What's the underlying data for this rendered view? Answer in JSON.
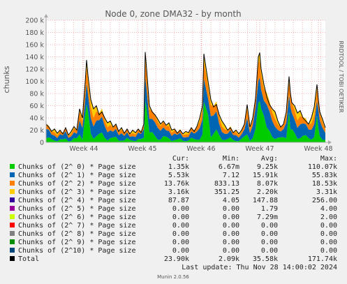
{
  "chart_data": {
    "type": "area",
    "title": "Node 0, zone DMA32 - by month",
    "ylabel": "chunks",
    "ylim": [
      0,
      200000
    ],
    "yticks": [
      0,
      20000,
      40000,
      60000,
      80000,
      100000,
      120000,
      140000,
      160000,
      180000,
      200000
    ],
    "ytick_labels": [
      "0",
      "20 k",
      "40 k",
      "60 k",
      "80 k",
      "100 k",
      "120 k",
      "140 k",
      "160 k",
      "180 k",
      "200 k"
    ],
    "xtick_labels": [
      "Week 44",
      "Week 45",
      "Week 46",
      "Week 47",
      "Week 48"
    ],
    "grid": true,
    "stacked": true,
    "series": [
      {
        "name": "Chunks of (2^ 0) * Page size",
        "color": "#00cc00",
        "cur": "1.35k",
        "min": "6.67m",
        "avg": "9.25k",
        "max": "110.07k"
      },
      {
        "name": "Chunks of (2^ 1) * Page size",
        "color": "#0066b3",
        "cur": "5.53k",
        "min": "7.12",
        "avg": "15.91k",
        "max": "55.83k"
      },
      {
        "name": "Chunks of (2^ 2) * Page size",
        "color": "#ff8000",
        "cur": "13.76k",
        "min": "833.13",
        "avg": "8.07k",
        "max": "18.53k"
      },
      {
        "name": "Chunks of (2^ 3) * Page size",
        "color": "#ffcc00",
        "cur": "3.16k",
        "min": "351.25",
        "avg": "2.20k",
        "max": "3.31k"
      },
      {
        "name": "Chunks of (2^ 4) * Page size",
        "color": "#330099",
        "cur": "87.87",
        "min": "4.05",
        "avg": "147.88",
        "max": "256.00"
      },
      {
        "name": "Chunks of (2^ 5) * Page size",
        "color": "#990099",
        "cur": "0.00",
        "min": "0.00",
        "avg": "1.79",
        "max": "4.00"
      },
      {
        "name": "Chunks of (2^ 6) * Page size",
        "color": "#ccff00",
        "cur": "0.00",
        "min": "0.00",
        "avg": "7.29m",
        "max": "2.00"
      },
      {
        "name": "Chunks of (2^ 7) * Page size",
        "color": "#ff0000",
        "cur": "0.00",
        "min": "0.00",
        "avg": "0.00",
        "max": "0.00"
      },
      {
        "name": "Chunks of (2^ 8) * Page size",
        "color": "#808080",
        "cur": "0.00",
        "min": "0.00",
        "avg": "0.00",
        "max": "0.00"
      },
      {
        "name": "Chunks of (2^ 9) * Page size",
        "color": "#008f00",
        "cur": "0.00",
        "min": "0.00",
        "avg": "0.00",
        "max": "0.00"
      },
      {
        "name": "Chunks of (2^10) * Page size",
        "color": "#00487d",
        "cur": "0.00",
        "min": "0.00",
        "avg": "0.00",
        "max": "0.00"
      },
      {
        "name": "Total",
        "color": "#000000",
        "cur": "23.90k",
        "min": "2.09k",
        "avg": "35.58k",
        "max": "171.74k"
      }
    ],
    "column_headers": [
      "Cur:",
      "Min:",
      "Avg:",
      "Max:"
    ],
    "profile": [
      [
        0.0,
        30000
      ],
      [
        0.01,
        25000
      ],
      [
        0.02,
        18000
      ],
      [
        0.03,
        22000
      ],
      [
        0.04,
        15000
      ],
      [
        0.05,
        20000
      ],
      [
        0.06,
        14000
      ],
      [
        0.07,
        24000
      ],
      [
        0.08,
        12000
      ],
      [
        0.09,
        18000
      ],
      [
        0.1,
        26000
      ],
      [
        0.11,
        20000
      ],
      [
        0.12,
        55000
      ],
      [
        0.13,
        40000
      ],
      [
        0.14,
        98000
      ],
      [
        0.145,
        135000
      ],
      [
        0.15,
        110000
      ],
      [
        0.16,
        70000
      ],
      [
        0.17,
        55000
      ],
      [
        0.18,
        60000
      ],
      [
        0.19,
        45000
      ],
      [
        0.2,
        50000
      ],
      [
        0.21,
        40000
      ],
      [
        0.22,
        32000
      ],
      [
        0.23,
        35000
      ],
      [
        0.24,
        25000
      ],
      [
        0.25,
        30000
      ],
      [
        0.26,
        18000
      ],
      [
        0.27,
        24000
      ],
      [
        0.28,
        15000
      ],
      [
        0.29,
        22000
      ],
      [
        0.3,
        14000
      ],
      [
        0.31,
        20000
      ],
      [
        0.32,
        16000
      ],
      [
        0.33,
        22000
      ],
      [
        0.34,
        16000
      ],
      [
        0.35,
        30000
      ],
      [
        0.355,
        148000
      ],
      [
        0.36,
        120000
      ],
      [
        0.37,
        60000
      ],
      [
        0.38,
        50000
      ],
      [
        0.39,
        45000
      ],
      [
        0.4,
        38000
      ],
      [
        0.41,
        30000
      ],
      [
        0.42,
        35000
      ],
      [
        0.43,
        28000
      ],
      [
        0.44,
        32000
      ],
      [
        0.45,
        20000
      ],
      [
        0.46,
        22000
      ],
      [
        0.47,
        15000
      ],
      [
        0.48,
        20000
      ],
      [
        0.49,
        14000
      ],
      [
        0.5,
        18000
      ],
      [
        0.51,
        16000
      ],
      [
        0.52,
        24000
      ],
      [
        0.53,
        18000
      ],
      [
        0.54,
        26000
      ],
      [
        0.55,
        40000
      ],
      [
        0.56,
        60000
      ],
      [
        0.565,
        145000
      ],
      [
        0.57,
        130000
      ],
      [
        0.58,
        100000
      ],
      [
        0.59,
        70000
      ],
      [
        0.6,
        58000
      ],
      [
        0.61,
        62000
      ],
      [
        0.62,
        45000
      ],
      [
        0.63,
        35000
      ],
      [
        0.64,
        28000
      ],
      [
        0.65,
        20000
      ],
      [
        0.66,
        24000
      ],
      [
        0.67,
        16000
      ],
      [
        0.68,
        20000
      ],
      [
        0.69,
        14000
      ],
      [
        0.7,
        20000
      ],
      [
        0.71,
        30000
      ],
      [
        0.72,
        62000
      ],
      [
        0.73,
        25000
      ],
      [
        0.74,
        40000
      ],
      [
        0.75,
        72000
      ],
      [
        0.76,
        140000
      ],
      [
        0.765,
        147000
      ],
      [
        0.77,
        120000
      ],
      [
        0.78,
        95000
      ],
      [
        0.79,
        75000
      ],
      [
        0.8,
        62000
      ],
      [
        0.81,
        55000
      ],
      [
        0.82,
        50000
      ],
      [
        0.83,
        35000
      ],
      [
        0.84,
        25000
      ],
      [
        0.85,
        30000
      ],
      [
        0.86,
        50000
      ],
      [
        0.87,
        108000
      ],
      [
        0.875,
        80000
      ],
      [
        0.88,
        65000
      ],
      [
        0.89,
        60000
      ],
      [
        0.9,
        48000
      ],
      [
        0.91,
        52000
      ],
      [
        0.92,
        40000
      ],
      [
        0.93,
        35000
      ],
      [
        0.94,
        30000
      ],
      [
        0.95,
        40000
      ],
      [
        0.96,
        58000
      ],
      [
        0.97,
        95000
      ],
      [
        0.975,
        70000
      ],
      [
        0.98,
        50000
      ],
      [
        0.99,
        38000
      ],
      [
        1.0,
        24000
      ]
    ]
  },
  "watermark": "RRDTOOL / TOBI OETIKER",
  "last_update": "Last update: Thu Nov 28 14:00:02 2024",
  "footer": "Munin 2.0.56"
}
